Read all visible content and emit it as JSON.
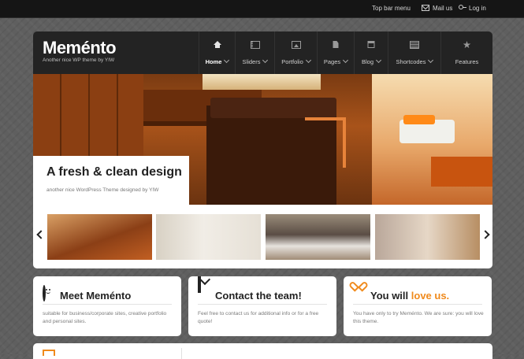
{
  "topbar": {
    "menu_label": "Top bar menu",
    "mail_label": "Mail us",
    "login_label": "Log in"
  },
  "header": {
    "logo": "Meménto",
    "tagline": "Another nice WP theme by YIW"
  },
  "nav": {
    "items": [
      {
        "label": "Home",
        "icon": "home-icon",
        "active": true,
        "dropdown": true
      },
      {
        "label": "Sliders",
        "icon": "film-icon",
        "active": false,
        "dropdown": true
      },
      {
        "label": "Portfolio",
        "icon": "picture-icon",
        "active": false,
        "dropdown": true
      },
      {
        "label": "Pages",
        "icon": "page-icon",
        "active": false,
        "dropdown": true
      },
      {
        "label": "Blog",
        "icon": "calendar-icon",
        "active": false,
        "dropdown": true
      },
      {
        "label": "Shortcodes",
        "icon": "shortcodes-icon",
        "active": false,
        "dropdown": true
      },
      {
        "label": "Features",
        "icon": "star-icon",
        "active": false,
        "dropdown": false
      }
    ]
  },
  "slider": {
    "caption_title": "A fresh & clean design",
    "caption_subtitle": "another nice WordPress Theme designed by YIW"
  },
  "cards": [
    {
      "title": "Meet Meménto",
      "title_accent": "",
      "icon": "smiley-icon",
      "text": "suitable for business/corporate sites, creative portfolio and personal sites."
    },
    {
      "title": "Contact the team!",
      "title_accent": "",
      "icon": "envelope-icon",
      "text": "Feel free to contact us for additional info or for a free quote!"
    },
    {
      "title": "You will ",
      "title_accent": "love us.",
      "icon": "heart-icon",
      "text": "You have only to try Meménto. We are sure: you will love this theme."
    }
  ],
  "colors": {
    "accent": "#f08a1c",
    "header_bg": "#232323",
    "topbar_bg": "#151515"
  }
}
